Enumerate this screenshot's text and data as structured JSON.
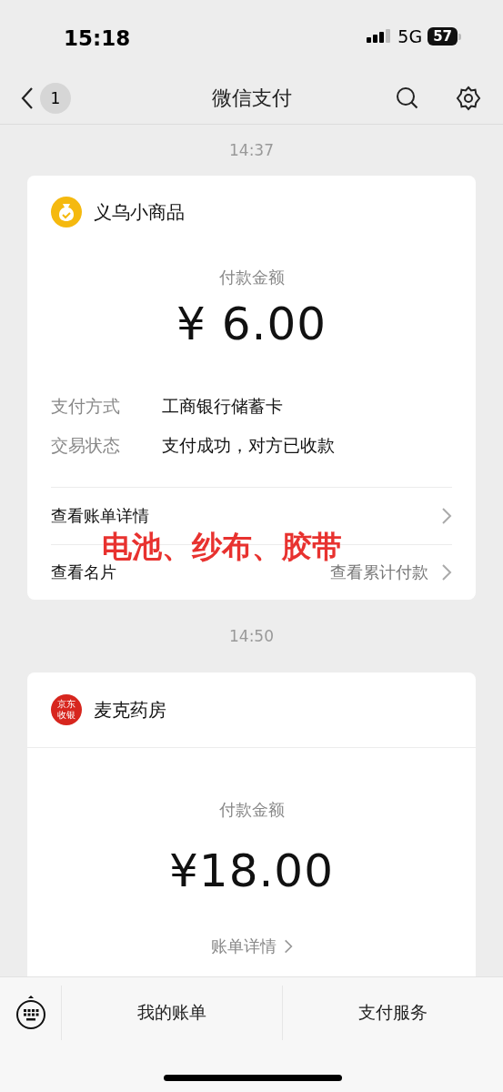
{
  "status_bar": {
    "time": "15:18",
    "network": "5G",
    "battery": "57"
  },
  "nav_bar": {
    "badge": "1",
    "title": "微信支付"
  },
  "messages": [
    {
      "time": "14:37",
      "card": {
        "kind": "detailed",
        "merchant": "义乌小商品",
        "logo": {
          "kind": "bag",
          "color": "#f5b90f"
        },
        "amount_label": "付款金额",
        "amount": "¥ 6.00",
        "fields": [
          {
            "label": "支付方式",
            "value": "工商银行储蓄卡"
          },
          {
            "label": "交易状态",
            "value": "支付成功，对方已收款"
          }
        ],
        "links": [
          {
            "label": "查看账单详情"
          },
          {
            "label": "查看名片",
            "extra": "查看累计付款"
          }
        ],
        "annotation": "电池、纱布、胶带"
      }
    },
    {
      "time": "14:50",
      "card": {
        "kind": "compact",
        "merchant": "麦克药房",
        "logo": {
          "kind": "text",
          "color": "#d7261e",
          "text": "京东收银"
        },
        "amount_label": "付款金额",
        "amount": "¥18.00",
        "detail_link": "账单详情"
      }
    }
  ],
  "bottom_bar": {
    "items": [
      "我的账单",
      "支付服务"
    ]
  }
}
